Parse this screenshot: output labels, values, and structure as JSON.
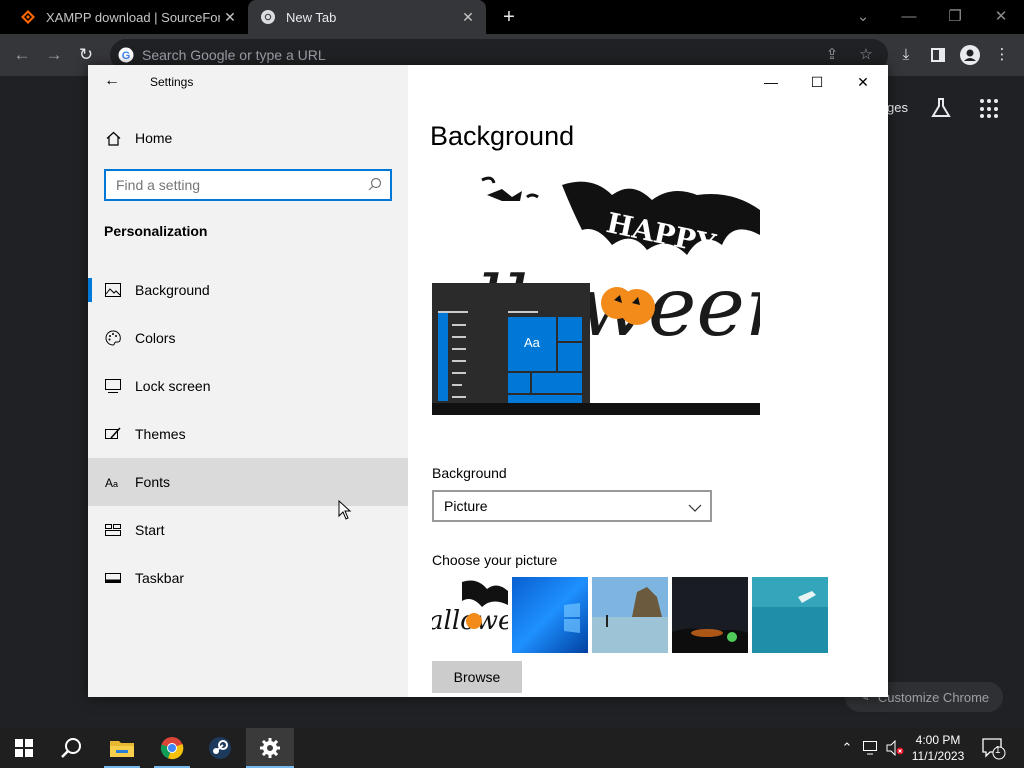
{
  "browser": {
    "tabs": [
      {
        "title": "XAMPP download | SourceForge",
        "close": "✕",
        "icon": "sourceforge-icon"
      },
      {
        "title": "New Tab",
        "close": "✕",
        "icon": "chrome-icon"
      }
    ],
    "new_tab": "+",
    "window_controls": {
      "down": "⌄",
      "minimize": "—",
      "restore": "❐",
      "close": "✕"
    },
    "omnibox_placeholder": "Search Google or type a URL",
    "ntp": {
      "images_link": "ges",
      "customize_label": "Customize Chrome"
    }
  },
  "settings": {
    "window_title": "Settings",
    "home_label": "Home",
    "search_placeholder": "Find a setting",
    "section_title": "Personalization",
    "nav_items": [
      {
        "label": "Background",
        "icon": "picture-icon",
        "selected": true
      },
      {
        "label": "Colors",
        "icon": "palette-icon"
      },
      {
        "label": "Lock screen",
        "icon": "lock-screen-icon"
      },
      {
        "label": "Themes",
        "icon": "brush-icon"
      },
      {
        "label": "Fonts",
        "icon": "font-icon",
        "hovered": true
      },
      {
        "label": "Start",
        "icon": "start-icon"
      },
      {
        "label": "Taskbar",
        "icon": "taskbar-icon"
      }
    ],
    "page_title": "Background",
    "preview": {
      "tile_text": "Aa"
    },
    "background_label": "Background",
    "background_value": "Picture",
    "choose_label": "Choose your picture",
    "browse_label": "Browse",
    "accent_color": "#0078d7"
  },
  "taskbar": {
    "apps": [
      "start-icon",
      "search-icon",
      "file-explorer-icon",
      "chrome-icon",
      "steam-icon",
      "settings-icon"
    ],
    "time": "4:00 PM",
    "date": "11/1/2023",
    "notification_count": "1"
  }
}
